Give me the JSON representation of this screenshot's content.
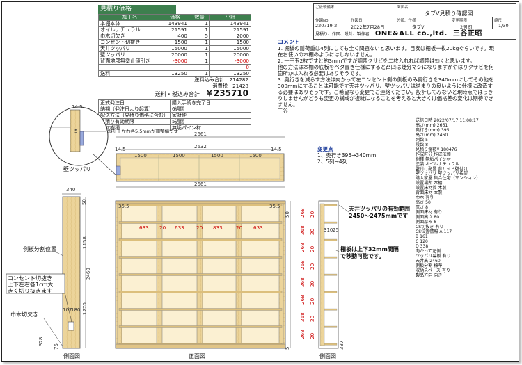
{
  "estimate": {
    "title": "見積り価格",
    "headers": [
      "加工名",
      "価格",
      "数量",
      "小計"
    ],
    "rows": [
      {
        "name": "本棚本体",
        "price": "143941",
        "qty": "1",
        "subtotal": "143941"
      },
      {
        "name": "オイルナチュラル",
        "price": "21591",
        "qty": "1",
        "subtotal": "21591"
      },
      {
        "name": "巾木切欠き",
        "price": "400",
        "qty": "5",
        "subtotal": "2000"
      },
      {
        "name": "コンセント切抜き",
        "price": "1500",
        "qty": "1",
        "subtotal": "1500"
      },
      {
        "name": "天井ツッパリ",
        "price": "15000",
        "qty": "1",
        "subtotal": "15000"
      },
      {
        "name": "壁ツッパリ",
        "price": "20000",
        "qty": "1",
        "subtotal": "20000"
      },
      {
        "name": "背面地部無塗止値引き",
        "price": "-3000",
        "qty": "1",
        "subtotal": "-3000"
      },
      {
        "name": "",
        "price": "",
        "qty": "",
        "subtotal": "0"
      },
      {
        "name": "送料",
        "price": "13250",
        "qty": "1",
        "subtotal": "13250"
      }
    ],
    "sum_label": "送料込み合計",
    "sum_value": "214282",
    "tax_label": "消費税",
    "tax_value": "21428",
    "grand_label": "送料・税込み合計",
    "grand_value": "￥235710",
    "info": [
      {
        "k": "正式発注日",
        "v": "購入手続き完了日"
      },
      {
        "k": "納期（発注日より起算）",
        "v": "6週間"
      },
      {
        "k": "配送方法（見積り価格に含む）",
        "v": "家財便"
      },
      {
        "k": "見積り有効期限",
        "v": "5週間"
      },
      {
        "k": "主材樹種",
        "v": "無垢パイン材"
      }
    ]
  },
  "titleblock": {
    "l_note": "ご依頼備考",
    "l_drawing": "図面名",
    "drawing_name": "タブV見積り確認図",
    "l_created": "作図No",
    "l_date": "作図日",
    "l_type": "分類、仕様",
    "type_val": "分類、仕様",
    "l_change": "変更期限",
    "l_scale": "縮尺",
    "drawing_no": "220719-2",
    "date": "2022年7月28日",
    "type": "タブV",
    "deadline": "2週間",
    "scale": "1/30",
    "subtitle": "見積り、作図、設計、製作者",
    "company": "ONE&ALL co.,ltd.",
    "person": "三谷正昭"
  },
  "comment": {
    "title": "コメント",
    "body": "1. 棚板の耐荷重は4列にしても全く問題ないと思います。目安は棚板一枚20kgぐらいです。現在お使いの本棚のようにはしないません。\n2. 一円玉2枚ですと約3mmですが調整クサビを二枚入れれば調整は効くと思います。\n他の方法は本棚の底板をベタ置き仕様にすると凸凹は幾分マシになりますがやはりクサビを何箇所かは入れる必要はありそうです。\n3. 奥行きを減らす方法は向かって左コンセント側の側板のみ奥行きを340mmにしてその他を300mmにすることは可能です天井ツッパリ、壁ツッパリは納まりの良いように仕様に改造する必要はありそうです。ご希望なら変更でご連絡ください。設計してみないと現時点ではっきりしませんがどうも変更の構成が複雑になることを考えると大きくは価格差の変化は期待できません。\n三谷"
  },
  "change": {
    "title": "変更点",
    "items": [
      "1、奥行き395→340mm",
      "2、5列→4列"
    ]
  },
  "spec": [
    "送信日時 2022/07/17 11:08:17",
    "高さ(mm) 2661",
    "奥行き(mm) 395",
    "高さ(mm) 2460",
    "列数 5",
    "段数 8",
    "見積り金額¥ 180476",
    "作成区分 作成依頼",
    "樹種 無垢パイン材",
    "塗装 オイルナチュラル",
    "壁付け配置 背サイド壁付け",
    "壁ツッパリ 壁ツッパリ希望",
    "購入家屋 集合住宅（マンション）",
    "設置場所 本棚",
    "設置床材質 木製",
    "背面床材 本製",
    "巾木 有り",
    "高さ 50",
    "厚さ 8",
    "側面床材 有り",
    "側面高さ 80",
    "側面厚み 8",
    "CS切抜き 有り",
    "CS位置情報 A 117",
    "B 161",
    "C 120",
    "D 338",
    "向かって左側",
    "ツッパリ幕板 有り",
    "天井高 2460",
    "側板分割 標準",
    "収納スペース 有り",
    "製品方向 向き"
  ],
  "drawing": {
    "label_wall_tsuppari": "壁ツッパリ",
    "note_notch": "斜計上左右各5.5mmが調整幅です",
    "label_side_split": "側板分割位置",
    "label_outlet": "コンセント切抜き",
    "label_outlet2": "上下左右各1cm大",
    "label_outlet3": "きく切り抜きます",
    "label_baseboard": "巾木切欠き",
    "label_ceiling": "天井ツッパリの有効範囲",
    "label_ceiling_range": "2450～2475mmです",
    "label_shelf1": "棚板は上下32mm間隔",
    "label_shelf2": "で移動可能です。",
    "view_side": "側面図",
    "view_front": "正面図",
    "view_side2": "側面図",
    "dim_2661": "2661",
    "dim_2632": "2632",
    "dim_14_5": "14.5",
    "dim_1500": "1500",
    "dim_340": "340",
    "dim_2460": "2460",
    "dim_1158": "1158",
    "dim_1270": "1270",
    "dim_35_5": "35.5",
    "dim_633": "633",
    "dim_20": "20",
    "dim_833": "833",
    "dim_107": "107",
    "dim_180": "180",
    "dim_328": "328",
    "dim_75": "75",
    "dim_50": "50",
    "dim_268": "268",
    "dim_310": "310",
    "dim_25": "25",
    "dim_337": "337",
    "dim_5": "5"
  }
}
